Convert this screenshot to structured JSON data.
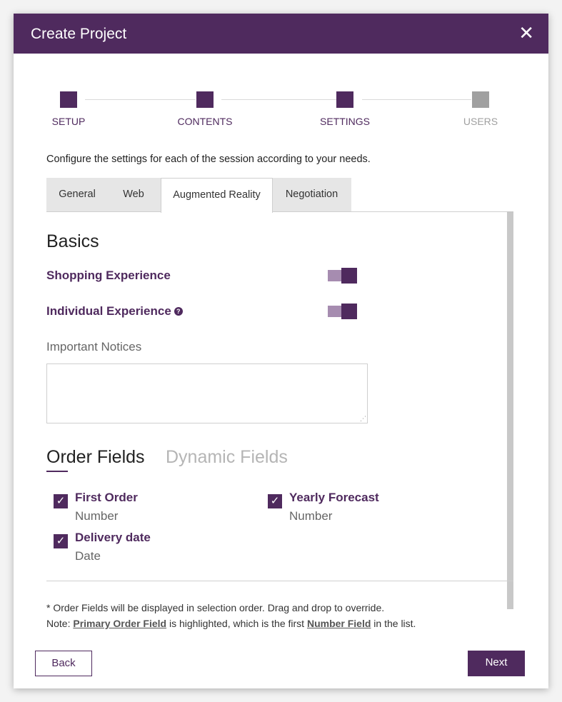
{
  "dialog": {
    "title": "Create Project",
    "close_icon": "close-icon",
    "brand_color": "#4f2a5e"
  },
  "stepper": {
    "steps": [
      {
        "label": "SETUP",
        "state": "done"
      },
      {
        "label": "CONTENTS",
        "state": "done"
      },
      {
        "label": "SETTINGS",
        "state": "current"
      },
      {
        "label": "USERS",
        "state": "pending"
      }
    ]
  },
  "intro": "Configure the settings for each of the session according to your needs.",
  "tabs": [
    {
      "label": "General"
    },
    {
      "label": "Web"
    },
    {
      "label": "Augmented Reality",
      "active": true
    },
    {
      "label": "Negotiation"
    }
  ],
  "basics": {
    "title": "Basics",
    "settings": [
      {
        "label": "Shopping Experience",
        "enabled": true
      },
      {
        "label": "Individual Experience",
        "enabled": true,
        "help_icon": "help-icon"
      }
    ],
    "notices_label": "Important Notices",
    "notices_value": ""
  },
  "fields_tabs": [
    {
      "label": "Order Fields",
      "active": true
    },
    {
      "label": "Dynamic Fields"
    }
  ],
  "fields": [
    {
      "name": "First Order",
      "type": "Number",
      "checked": true
    },
    {
      "name": "Yearly Forecast",
      "type": "Number",
      "checked": true
    },
    {
      "name": "Delivery date",
      "type": "Date",
      "checked": true
    }
  ],
  "footnotes": {
    "line1": "* Order Fields will be displayed in selection order. Drag and drop to override.",
    "line2_prefix": "Note: ",
    "line2_link1": "Primary Order Field",
    "line2_middle": " is highlighted, which is the first ",
    "line2_link2": "Number Field",
    "line2_suffix": " in the list."
  },
  "buttons": {
    "back": "Back",
    "next": "Next"
  }
}
